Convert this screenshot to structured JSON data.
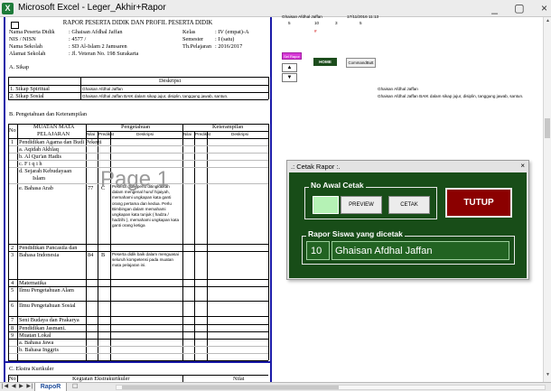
{
  "window": {
    "title": "Microsoft Excel - Leger_Akhir+Rapor",
    "controls": [
      "_",
      "▢",
      "×"
    ]
  },
  "page": {
    "title": "RAPOR PESERTA DIDIK DAN PROFIL PESERTA DIDIK",
    "watermark": "Page 1",
    "identity": {
      "nama_label": "Nama Peserta Didik",
      "nama_value": ":  Ghaisan Afdhal Jaffan",
      "nis_label": "NIS / NISN",
      "nis_value": ":  4577 /",
      "sekolah_label": "Nama Sekolah",
      "sekolah_value": ":  SD Al-Islam 2 Jamsaren",
      "alamat_label": "Alamat Sekolah",
      "alamat_value": ":  Jl. Veteran No. 198 Surakarta",
      "kelas_label": "Kelas",
      "kelas_value": ":  IV (empat)-A",
      "semester_label": "Semester",
      "semester_value": ":  I (satu)",
      "tp_label": "Th.Pelajaran",
      "tp_value": ":  2016/2017"
    },
    "sikap": {
      "heading": "A.  Sikap",
      "desc_header": "Deskripsi",
      "rows": [
        {
          "label": "1.  Sikap Spiritual",
          "desc": "Ghaisan Afdhal Jaffan"
        },
        {
          "label": "2.  Sikap Sosial",
          "desc": "Ghaisan Afdhal Jaffan BAIK dalam sikap jujur, disiplin, tanggung jawab, santun."
        }
      ]
    },
    "pk": {
      "heading": "B.  Pengetahuan dan Keterampilan",
      "col_no": "No",
      "col_mapel_1": "MUATAN MATA",
      "col_mapel_2": "PELAJARAN",
      "col_peng": "Pengetahuan",
      "col_ket": "Keterampilan",
      "sub_nilai": "Nilai",
      "sub_predikat": "Predikat",
      "sub_deskripsi": "Deskripsi",
      "rows": [
        {
          "no": "1",
          "mapel": "Pendidikan Agama dan Budi Pekerti"
        },
        {
          "no": "",
          "mapel": "a.   Aqidah Akhlaq"
        },
        {
          "no": "",
          "mapel": "b.   Al Qur'an Hadis"
        },
        {
          "no": "",
          "mapel": "c.   F i q i h"
        },
        {
          "no": "",
          "mapel": "d.   Sejarah Kebudayaan"
        },
        {
          "no": "",
          "mapel": "Islam"
        },
        {
          "no": "",
          "mapel": "e.   Bahasa Arab"
        },
        {
          "no": "2",
          "mapel": "Pendidikan Pancasila dan"
        },
        {
          "no": "3",
          "mapel": "Bahasa Indonesia"
        },
        {
          "no": "4",
          "mapel": "Matematika"
        },
        {
          "no": "5",
          "mapel": "Ilmu Pengetahuan Alam"
        },
        {
          "no": "6",
          "mapel": "Ilmu Pengetahuan Sosial"
        },
        {
          "no": "7",
          "mapel": "Seni Budaya dan Prakarya"
        },
        {
          "no": "8",
          "mapel": "Pendidikan Jasmani,"
        },
        {
          "no": "9",
          "mapel": "Muatan Lokal"
        },
        {
          "no": "",
          "mapel": "a.   Bahasa Jawa"
        },
        {
          "no": "",
          "mapel": "b.   Bahasa Inggris"
        }
      ],
      "arab_nilai": "77",
      "arab_pred": "C",
      "arab_desc": "Peserta didik perlu ditingkatkan dalam mengenal huruf hijaiyah, memahami ungkapan kata ganti orang pertama dan kedua. Perlu Bimbingan dalam memahami ungkapan kata tunjuk ( hadza / hadzihi ), memahami ungkapan kata ganti orang ketiga",
      "indo_nilai": "84",
      "indo_pred": "B",
      "indo_desc": "Peserta didik baik dalam menguasai seluruh kompetensi pada muatan mata pelajaran ini."
    },
    "ekstra": {
      "heading": "C.  Ekstra Kurikuler",
      "col_no": "No",
      "col_kegiatan": "Kegiatan Ekstrakurikuler",
      "col_nilai": "Nilai"
    }
  },
  "right": {
    "header_name": "Ghaisan Afdhal Jaffan",
    "header_date": "17/11/2016 11:13",
    "row_numbers": [
      "5",
      "10",
      "3",
      "5"
    ],
    "marker": "#",
    "sel_rapor": "Sel Rapor",
    "up": "▲",
    "down": "▼",
    "home_label": "HOME",
    "cmd_label": "CommandButt",
    "spiritual_echo": "Ghaisan Afdhal Jaffan",
    "sosial_echo": "Ghaisan Afdhal Jaffan BAIK dalam sikap jujur, disiplin, tanggung jawab, santun."
  },
  "dialog": {
    "title": ".: Cetak Rapor :.",
    "close": "×",
    "no_awal_legend": "No Awal Cetak",
    "no_awal_value": "",
    "preview_label": "PREVIEW",
    "cetak_label": "CETAK",
    "tutup_label": "TUTUP",
    "dicetak_legend": "Rapor Siswa yang dicetak",
    "number": "10",
    "name": "Ghaisan Afdhal Jaffan"
  },
  "tabs": {
    "nav": "|◀ ◀ ▶ ▶|",
    "active": "RapoR",
    "add": "☐"
  },
  "colors": {
    "dialog_bg": "#184d18",
    "tutup": "#8b0000",
    "input_bg": "#b5f2b5",
    "page_border": "#1a1aa8"
  }
}
